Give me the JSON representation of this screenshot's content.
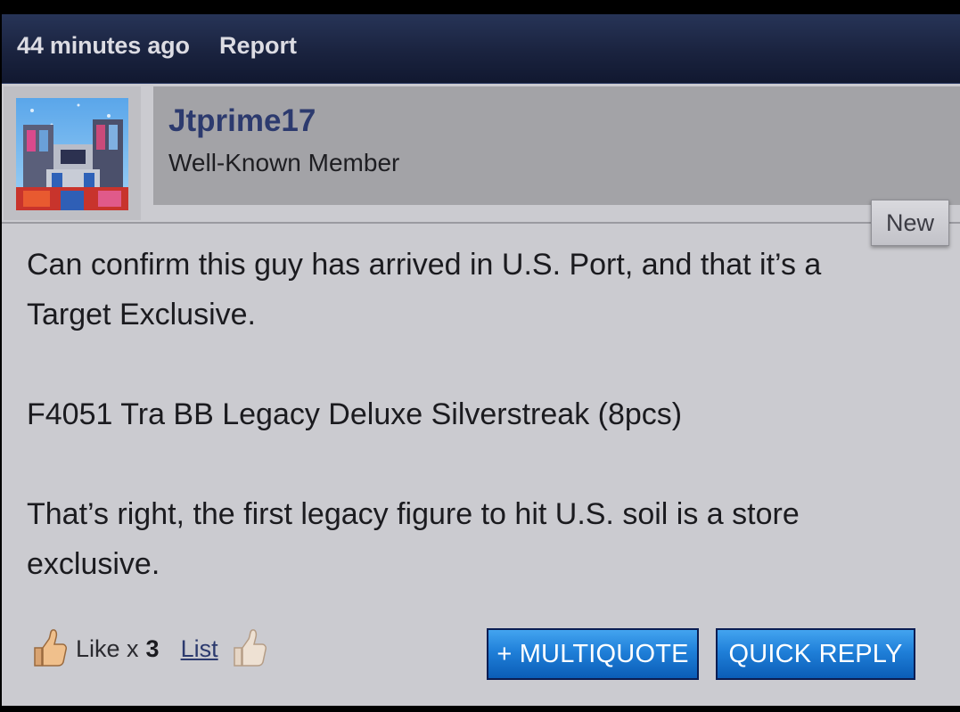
{
  "post_header": {
    "time_label": "44 minutes ago",
    "report_label": "Report"
  },
  "user": {
    "username": "Jtprime17",
    "title": "Well-Known Member",
    "avatar_icon": "transformer-avatar-image"
  },
  "badge": {
    "label": "New"
  },
  "post_body": {
    "paragraphs": [
      "Can confirm this guy has arrived in U.S. Port, and that it’s a Target Exclusive.",
      "F4051 Tra BB Legacy Deluxe Silverstreak (8pcs)",
      "That’s right, the first legacy figure to hit U.S. soil is a store exclusive."
    ]
  },
  "footer": {
    "like_text": "Like x",
    "like_count": "3",
    "list_label": "List",
    "thumb_icon": "thumbs-up-icon"
  },
  "buttons": {
    "multiquote_label": "+ MULTIQUOTE",
    "quick_reply_label": "QUICK REPLY"
  },
  "colors": {
    "header_bg": "#1a233f",
    "username": "#2c3a6e",
    "button_blue": "#1f7fd8",
    "post_bg": "#cbcbd0"
  }
}
